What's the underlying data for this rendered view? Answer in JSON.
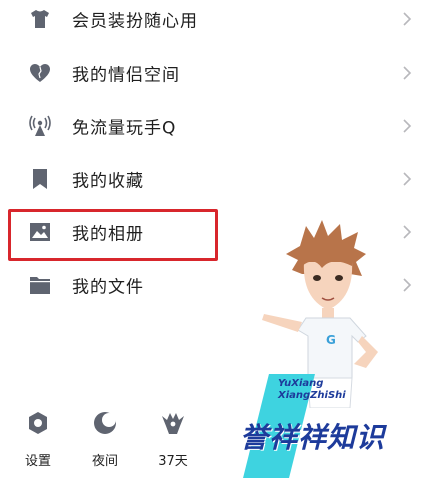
{
  "menu": {
    "items": [
      {
        "label": "会员装扮随心用",
        "icon": "tshirt-icon"
      },
      {
        "label": "我的情侣空间",
        "icon": "heart-icon"
      },
      {
        "label": "免流量玩手Q",
        "icon": "signal-tower-icon"
      },
      {
        "label": "我的收藏",
        "icon": "bookmark-icon"
      },
      {
        "label": "我的相册",
        "icon": "photo-icon"
      },
      {
        "label": "我的文件",
        "icon": "folder-icon"
      }
    ]
  },
  "highlighted_item": "我的相册",
  "bottom_bar": {
    "settings_label": "设置",
    "night_label": "夜间",
    "weather_label": "37天"
  },
  "watermark": {
    "line1": "YuXiang",
    "line2": "XiangZhiShi",
    "chinese": "誉祥祥知识"
  },
  "colors": {
    "icon_gray": "#5f6470",
    "highlight_red": "#d8262c",
    "watermark_blue": "#1d3b9b",
    "watermark_cyan": "#3ed3e0"
  }
}
